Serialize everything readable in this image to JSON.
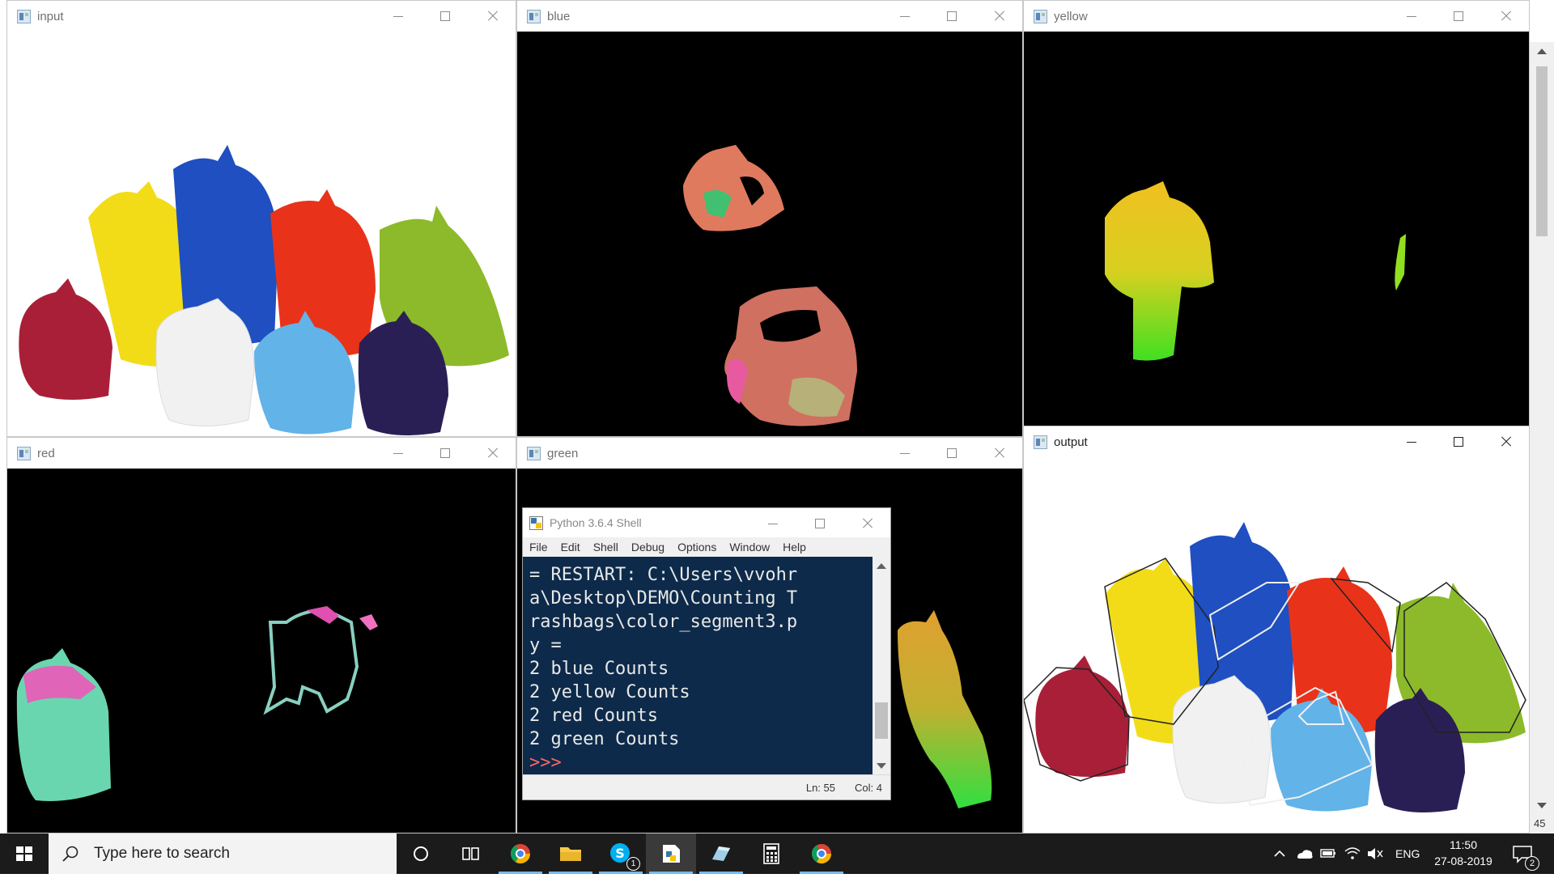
{
  "windows": {
    "input": {
      "title": "input"
    },
    "blue": {
      "title": "blue"
    },
    "yellow": {
      "title": "yellow"
    },
    "red": {
      "title": "red"
    },
    "green": {
      "title": "green"
    },
    "output": {
      "title": "output"
    }
  },
  "shell": {
    "title": "Python 3.6.4 Shell",
    "menu": [
      "File",
      "Edit",
      "Shell",
      "Debug",
      "Options",
      "Window",
      "Help"
    ],
    "lines": [
      "= RESTART: C:\\Users\\vvohr",
      "a\\Desktop\\DEMO\\Counting T",
      "rashbags\\color_segment3.p",
      "y =",
      "2 blue Counts",
      "2 yellow Counts",
      "2 red Counts",
      "2 green Counts"
    ],
    "prompt": ">>>",
    "status_ln": "Ln: 55",
    "status_col": "Col: 4"
  },
  "taskbar": {
    "search_placeholder": "Type here to search",
    "lang": "ENG",
    "time": "11:50",
    "date": "27-08-2019",
    "notif_count": "2",
    "skype_badge": "1"
  },
  "edge_label": "45",
  "colors": {
    "console_bg": "#0d2a4a",
    "prompt": "#ff6666",
    "taskbar": "#1b1b1b"
  }
}
